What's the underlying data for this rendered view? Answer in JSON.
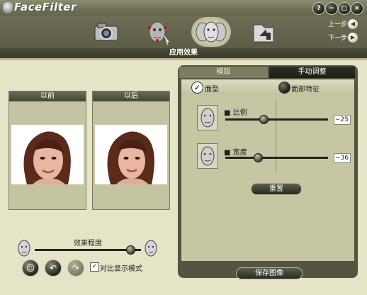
{
  "app": {
    "title": "FaceFilter"
  },
  "window_buttons": {
    "help": "?",
    "minimize": "−",
    "restore": "□",
    "close": "×"
  },
  "toolbar": {
    "items": [
      {
        "name": "camera-icon"
      },
      {
        "name": "face-target-icon"
      },
      {
        "name": "faces-icon",
        "selected": true
      },
      {
        "name": "folder-icon"
      }
    ],
    "prev_label": "上一步",
    "next_label": "下一步"
  },
  "section": {
    "title": "应用效果"
  },
  "preview": {
    "before_label": "以前",
    "after_label": "以后"
  },
  "effect": {
    "label": "效果程度",
    "level": 0.9
  },
  "compare_checkbox": {
    "label": "对比显示模式",
    "checked": true
  },
  "tabs": [
    {
      "label": "模版",
      "active": false
    },
    {
      "label": "手动调整",
      "active": true
    }
  ],
  "options": [
    {
      "label": "面型",
      "checked": true
    },
    {
      "label": "面部特征",
      "checked": false
    }
  ],
  "adjust": [
    {
      "label": "比例",
      "value": "−25",
      "level": 0.37
    },
    {
      "label": "宽度",
      "value": "−36",
      "level": 0.32
    }
  ],
  "reset_label": "重置",
  "save_label": "保存图像",
  "colors": {
    "panel_bg": "#e6e4c6",
    "dark_bar": "#545440",
    "accent": "#2f2f24"
  }
}
